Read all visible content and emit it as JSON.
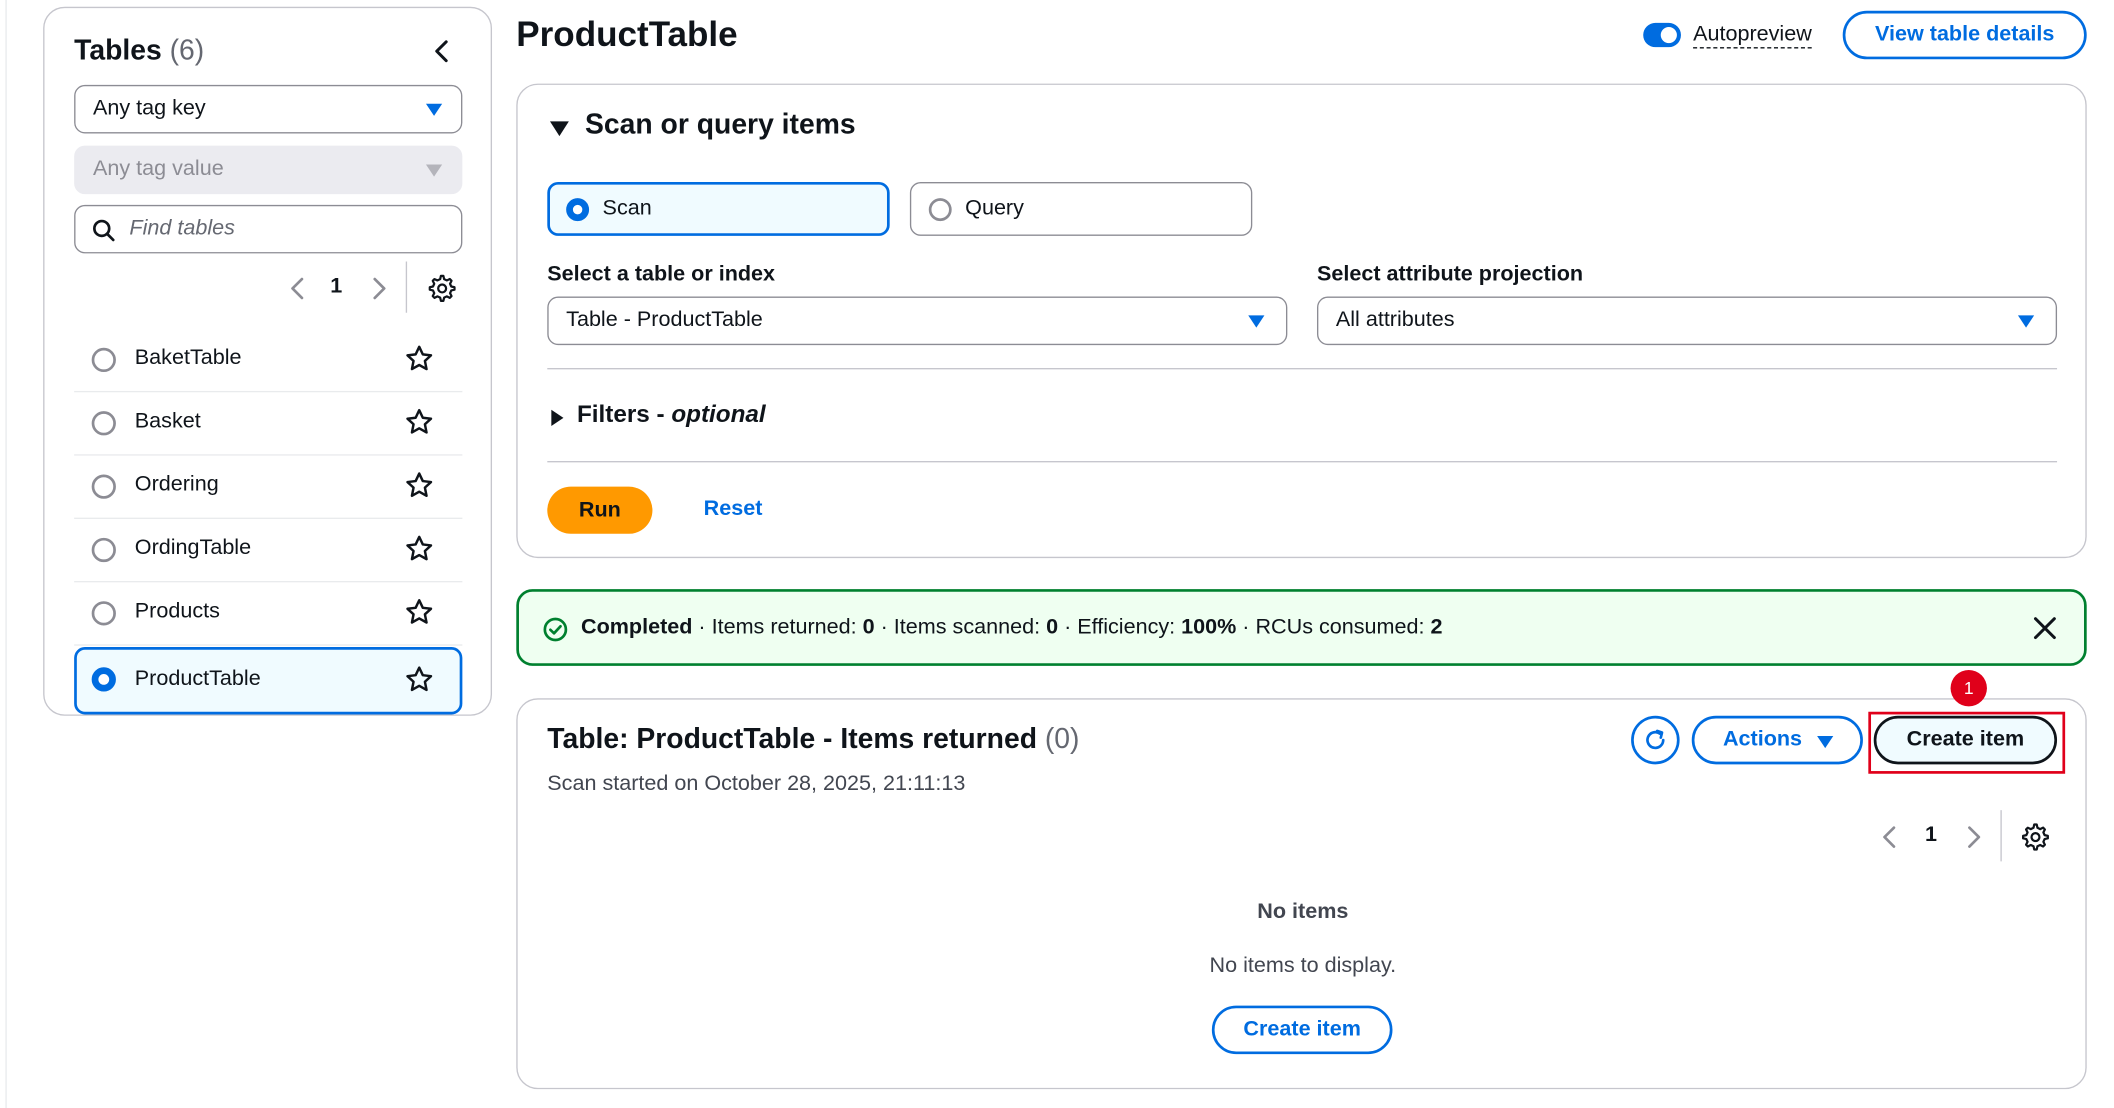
{
  "sidebar": {
    "title": "Tables",
    "count": "(6)",
    "tag_key": "Any tag key",
    "tag_value": "Any tag value",
    "search_placeholder": "Find tables",
    "page": "1",
    "tables": [
      {
        "label": "BaketTable",
        "selected": false
      },
      {
        "label": "Basket",
        "selected": false
      },
      {
        "label": "Ordering",
        "selected": false
      },
      {
        "label": "OrdingTable",
        "selected": false
      },
      {
        "label": "Products",
        "selected": false
      },
      {
        "label": "ProductTable",
        "selected": true
      }
    ]
  },
  "header": {
    "title": "ProductTable",
    "autopreview_label": "Autopreview",
    "autopreview_on": true,
    "view_details": "View table details"
  },
  "scan": {
    "section_title": "Scan or query items",
    "mode_scan": "Scan",
    "mode_query": "Query",
    "selected_mode": "Scan",
    "table_label": "Select a table or index",
    "table_value": "Table - ProductTable",
    "projection_label": "Select attribute projection",
    "projection_value": "All attributes",
    "filters_label": "Filters - ",
    "filters_optional": "optional",
    "run": "Run",
    "reset": "Reset"
  },
  "flash": {
    "status": "Completed",
    "items_returned_label": " · Items returned: ",
    "items_returned": "0",
    "items_scanned_label": " · Items scanned: ",
    "items_scanned": "0",
    "efficiency_label": " · Efficiency: ",
    "efficiency": "100%",
    "rcus_label": " · RCUs consumed: ",
    "rcus": "2"
  },
  "results": {
    "title": "Table: ProductTable - Items returned",
    "count": "(0)",
    "subtitle": "Scan started on October 28, 2025, 21:11:13",
    "actions": "Actions",
    "create_item": "Create item",
    "badge": "1",
    "page": "1",
    "empty_title": "No items",
    "empty_text": "No items to display.",
    "empty_create": "Create item"
  },
  "colors": {
    "accent": "#006ce0",
    "run": "#ff9900",
    "success": "#00802f",
    "highlight": "#e0001a"
  }
}
